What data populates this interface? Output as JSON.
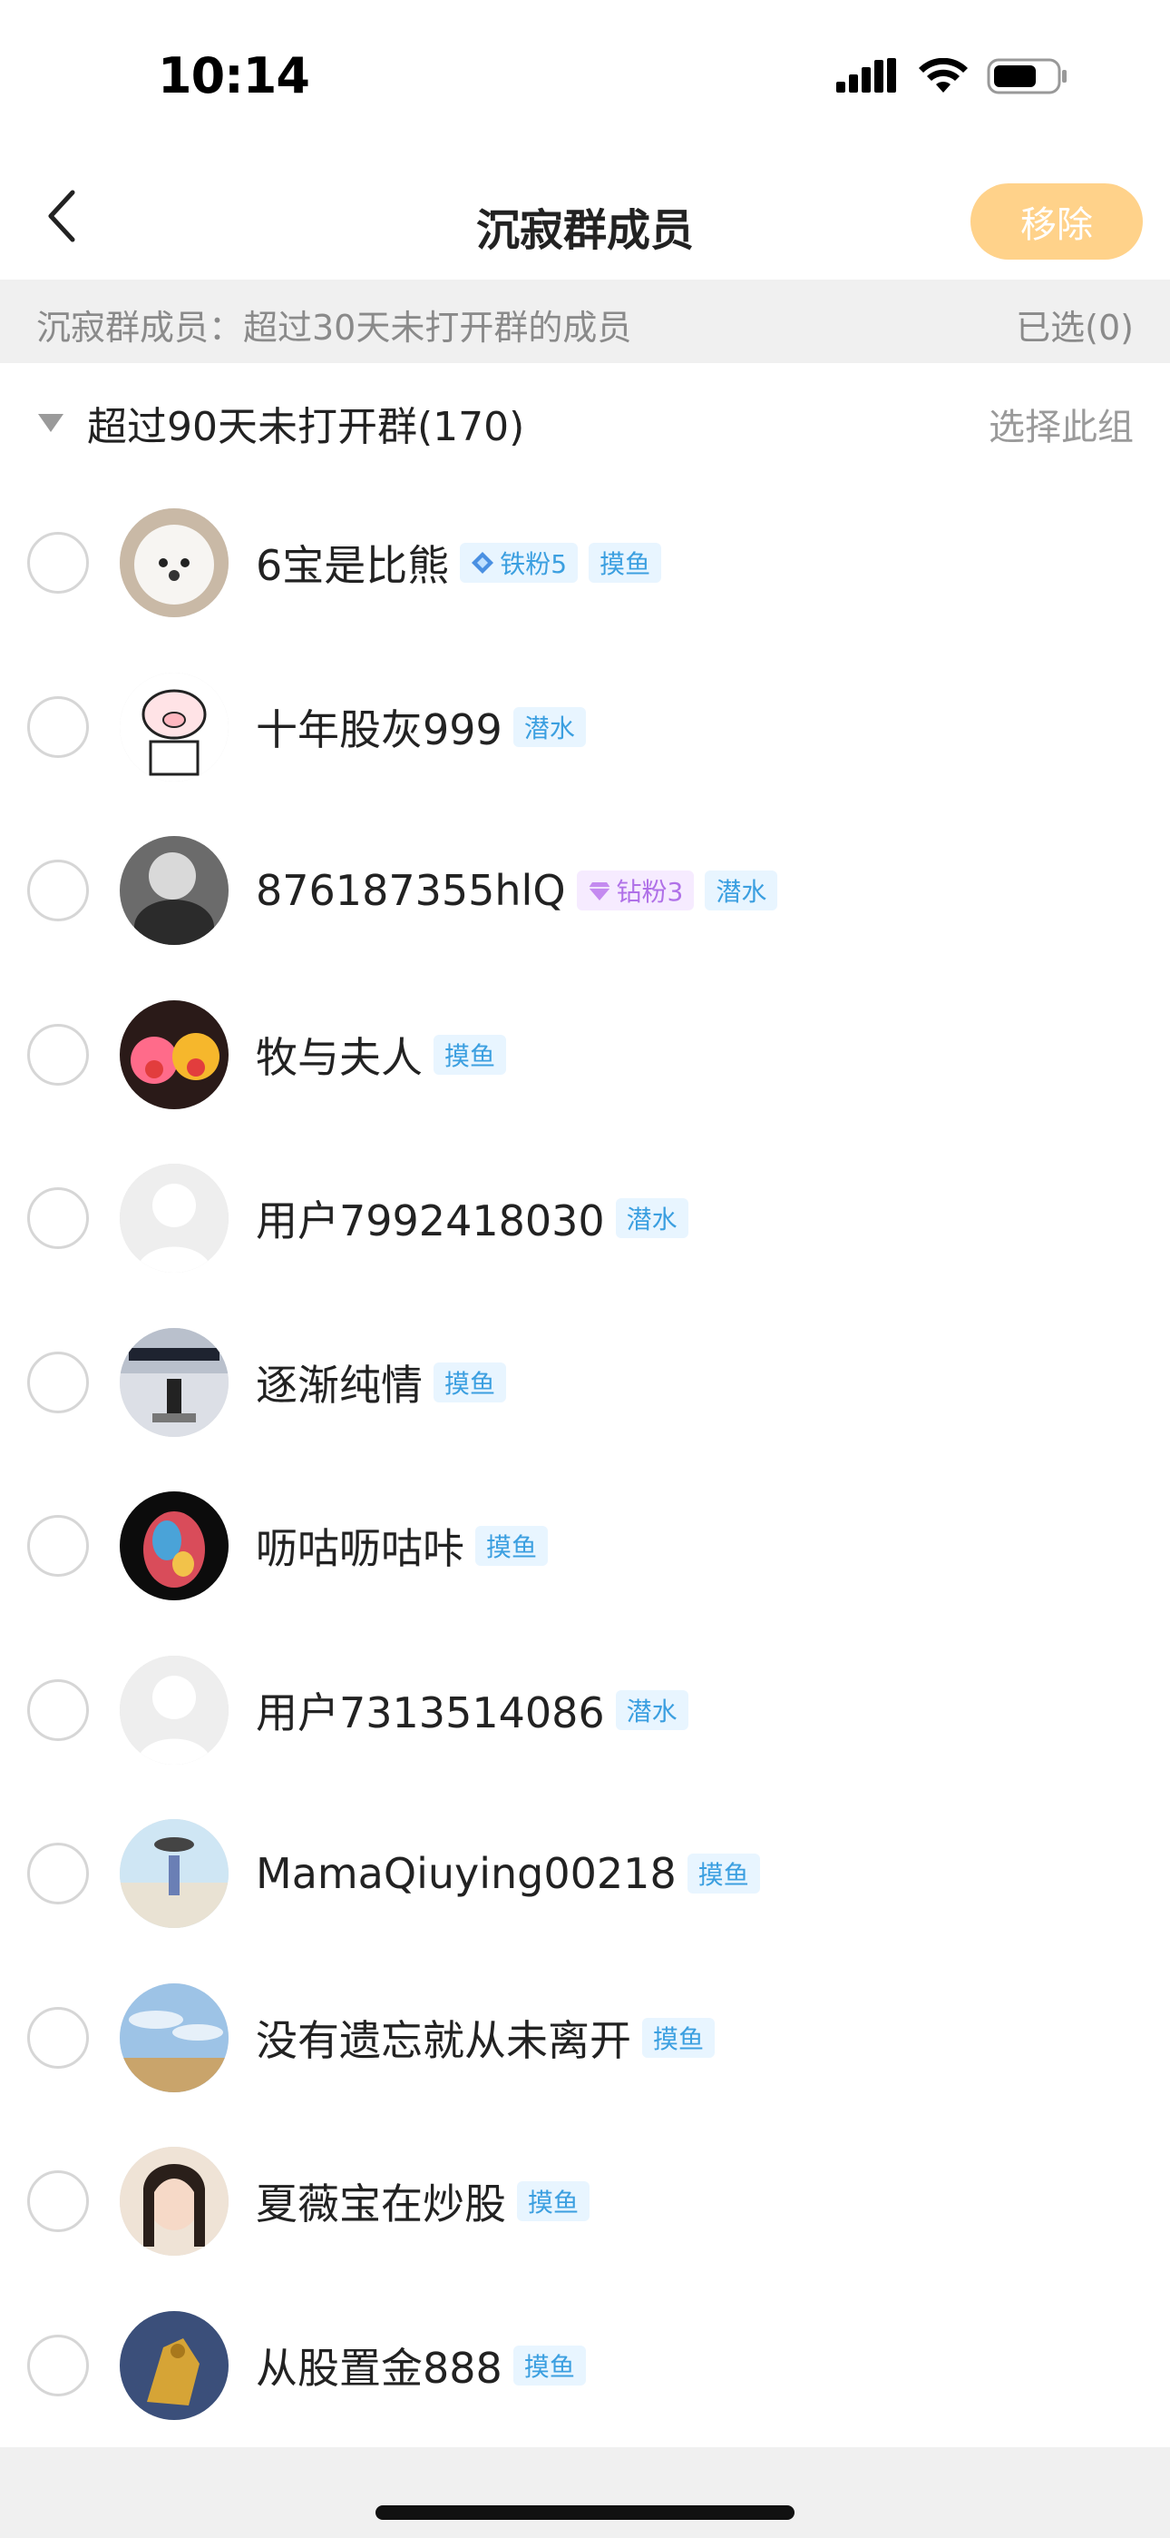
{
  "status_bar": {
    "time": "10:14"
  },
  "header": {
    "back_icon": "chevron-left-icon",
    "title": "沉寂群成员",
    "remove_label": "移除"
  },
  "info_bar": {
    "text": "沉寂群成员：超过30天未打开群的成员",
    "selected": "已选(0)"
  },
  "group": {
    "title": "超过90天未打开群(170)",
    "select_label": "选择此组"
  },
  "colors": {
    "remove_button_bg": "#ffd28a",
    "tag_blue": "#3b9fe0",
    "tag_purple": "#b071e8"
  },
  "members": [
    {
      "name": "6宝是比熊",
      "tags": [
        {
          "label": "铁粉5",
          "style": "fan",
          "icon": "iron-fan-badge-icon"
        },
        {
          "label": "摸鱼",
          "style": "plain"
        }
      ]
    },
    {
      "name": "十年股灰999",
      "tags": [
        {
          "label": "潜水",
          "style": "plain"
        }
      ]
    },
    {
      "name": "876187355hlQ",
      "tags": [
        {
          "label": "钻粉3",
          "style": "diamond",
          "icon": "diamond-fan-badge-icon"
        },
        {
          "label": "潜水",
          "style": "plain"
        }
      ]
    },
    {
      "name": "牧与夫人",
      "tags": [
        {
          "label": "摸鱼",
          "style": "plain"
        }
      ]
    },
    {
      "name": "用户7992418030",
      "tags": [
        {
          "label": "潜水",
          "style": "plain"
        }
      ]
    },
    {
      "name": "逐渐纯情",
      "tags": [
        {
          "label": "摸鱼",
          "style": "plain"
        }
      ]
    },
    {
      "name": "呖咕呖咕咔",
      "tags": [
        {
          "label": "摸鱼",
          "style": "plain"
        }
      ]
    },
    {
      "name": "用户7313514086",
      "tags": [
        {
          "label": "潜水",
          "style": "plain"
        }
      ]
    },
    {
      "name": "MamaQiuying00218",
      "tags": [
        {
          "label": "摸鱼",
          "style": "plain"
        }
      ]
    },
    {
      "name": "没有遗忘就从未离开",
      "tags": [
        {
          "label": "摸鱼",
          "style": "plain"
        }
      ]
    },
    {
      "name": "夏薇宝在炒股",
      "tags": [
        {
          "label": "摸鱼",
          "style": "plain"
        }
      ]
    },
    {
      "name": "从股置金888",
      "tags": [
        {
          "label": "摸鱼",
          "style": "plain"
        }
      ]
    }
  ]
}
